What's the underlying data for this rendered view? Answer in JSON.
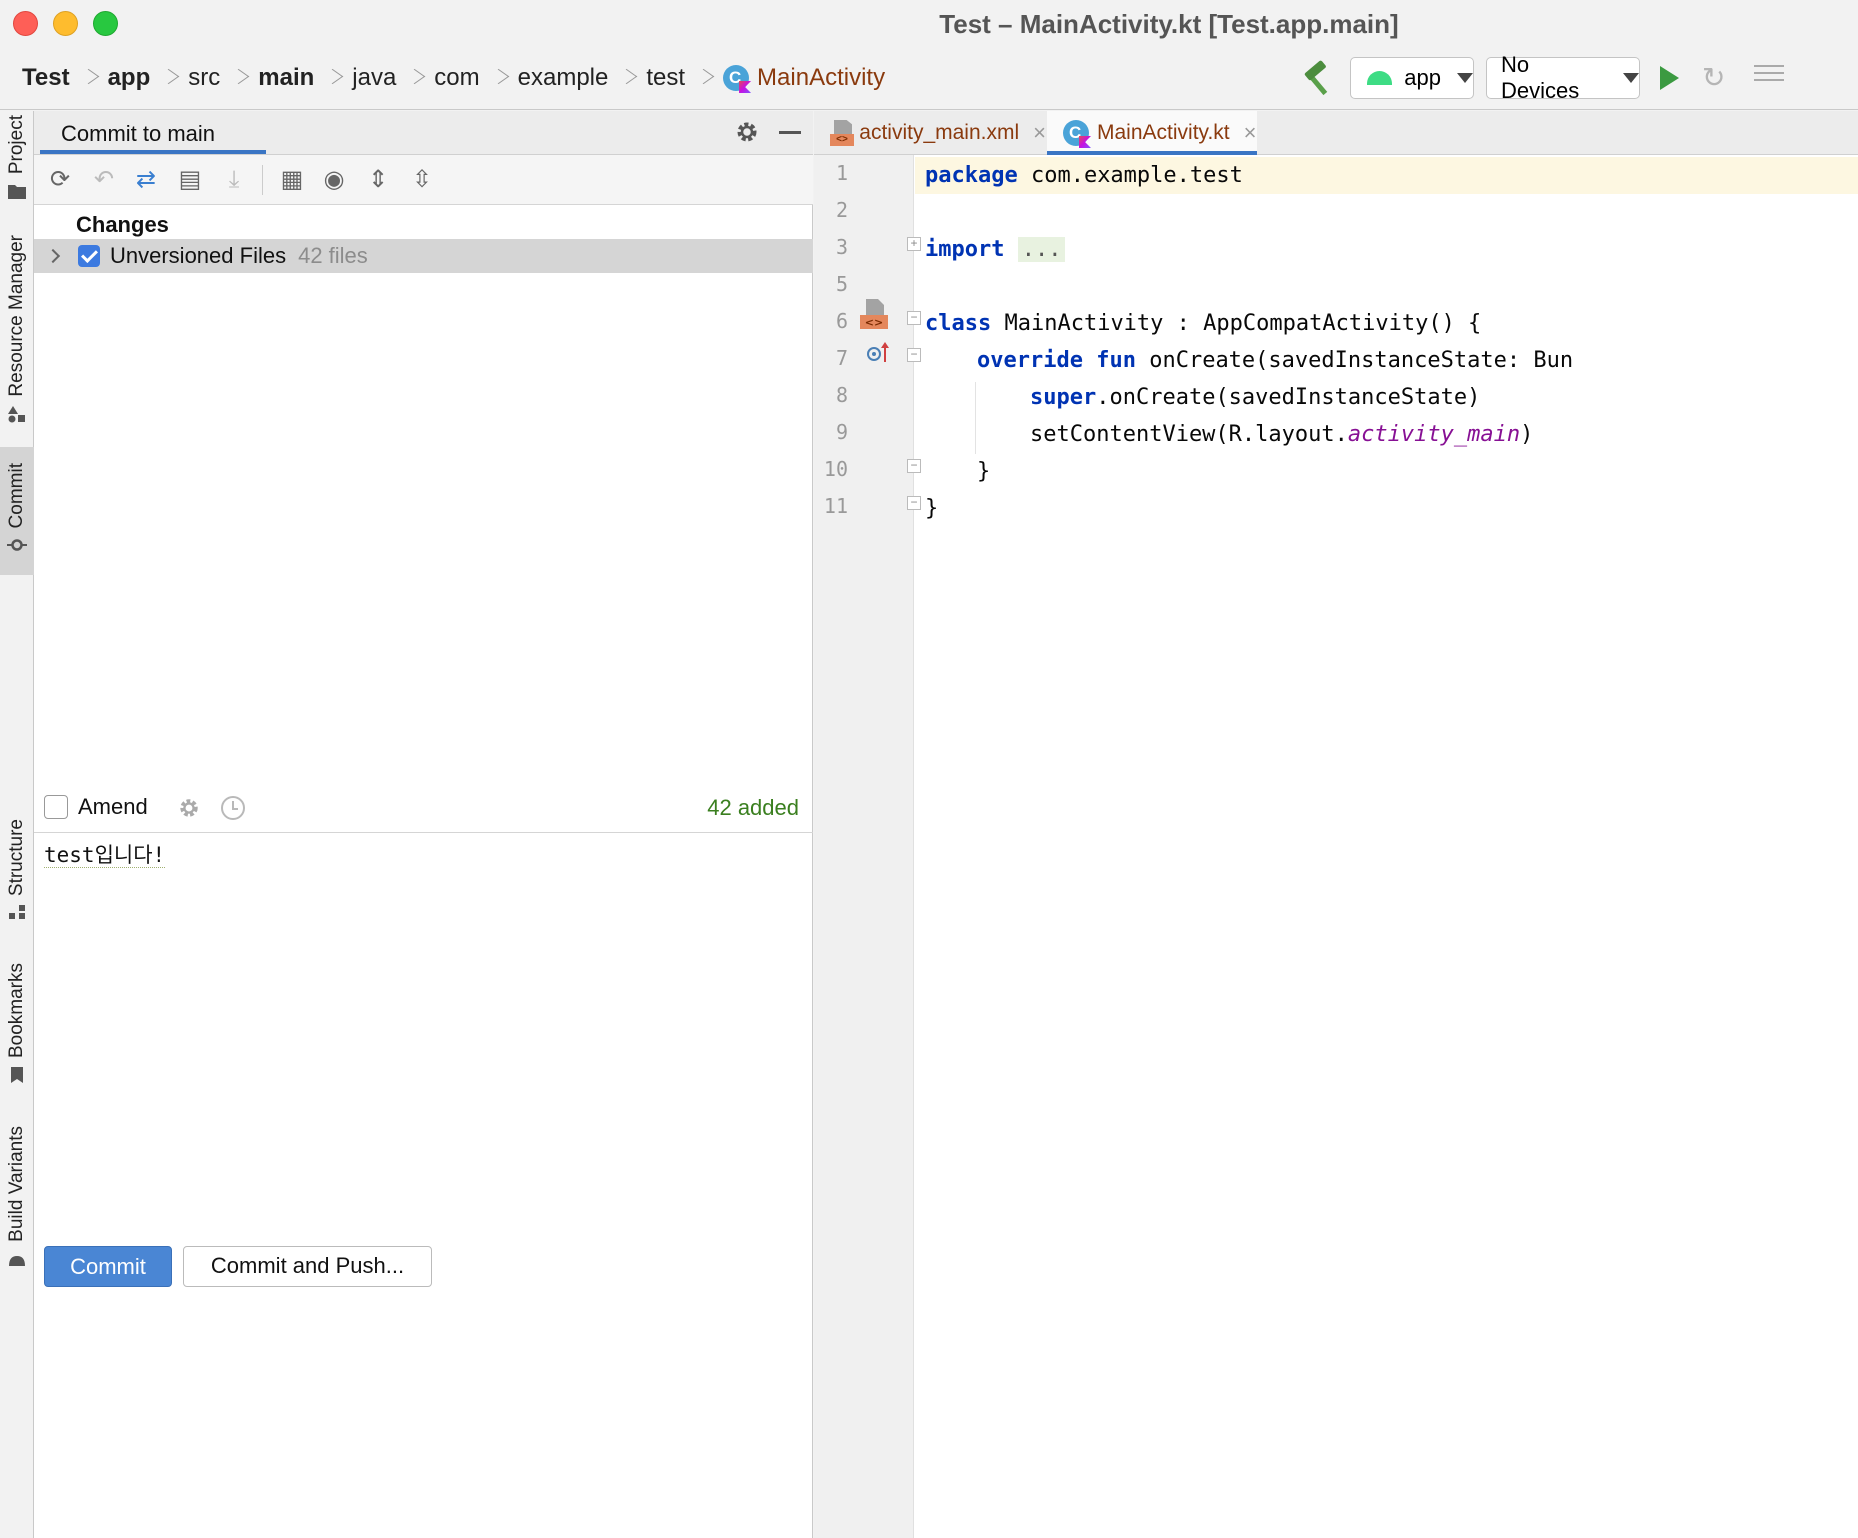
{
  "window": {
    "title": "Test – MainActivity.kt [Test.app.main]"
  },
  "breadcrumbs": [
    {
      "label": "Test",
      "bold": true
    },
    {
      "label": "app",
      "bold": true
    },
    {
      "label": "src",
      "bold": false
    },
    {
      "label": "main",
      "bold": true
    },
    {
      "label": "java",
      "bold": false
    },
    {
      "label": "com",
      "bold": false
    },
    {
      "label": "example",
      "bold": false
    },
    {
      "label": "test",
      "bold": false
    },
    {
      "label": "MainActivity",
      "bold": false,
      "is_file": true
    }
  ],
  "toolbar": {
    "run_config": "app",
    "device": "No Devices"
  },
  "left_strip": {
    "tabs": [
      "Project",
      "Resource Manager",
      "Commit",
      "Structure",
      "Bookmarks",
      "Build Variants"
    ],
    "active": "Commit"
  },
  "commit_panel": {
    "title": "Commit to main",
    "changes_heading": "Changes",
    "unversioned_label": "Unversioned Files",
    "unversioned_count": "42 files",
    "amend_label": "Amend",
    "added_summary": "42 added",
    "commit_message": "test입니다!",
    "commit_button": "Commit",
    "commit_push_button": "Commit and Push..."
  },
  "editor": {
    "tabs": [
      {
        "label": "activity_main.xml",
        "active": false,
        "icon": "xml-file-icon"
      },
      {
        "label": "MainActivity.kt",
        "active": true,
        "icon": "kotlin-class-icon"
      }
    ],
    "line_numbers": [
      "1",
      "2",
      "3",
      "5",
      "6",
      "7",
      "8",
      "9",
      "10",
      "11"
    ],
    "code": {
      "l1_kw": "package",
      "l1_rest": " com.example.test",
      "l3_kw": "import",
      "l3_fold": "...",
      "l6_kw": "class",
      "l6_rest": " MainActivity : AppCompatActivity() {",
      "l7_kw1": "override",
      "l7_kw2": "fun",
      "l7_rest": " onCreate(savedInstanceState: Bun",
      "l8_kw": "super",
      "l8_rest": ".onCreate(savedInstanceState)",
      "l9_pre": "setContentView(R.layout.",
      "l9_ital": "activity_main",
      "l9_post": ")",
      "l10": "}",
      "l11": "}"
    }
  },
  "colors": {
    "accent": "#3a75c4",
    "commit_button": "#4a86d4",
    "added_green": "#3a7f1f",
    "keyword_blue": "#0033b3"
  }
}
